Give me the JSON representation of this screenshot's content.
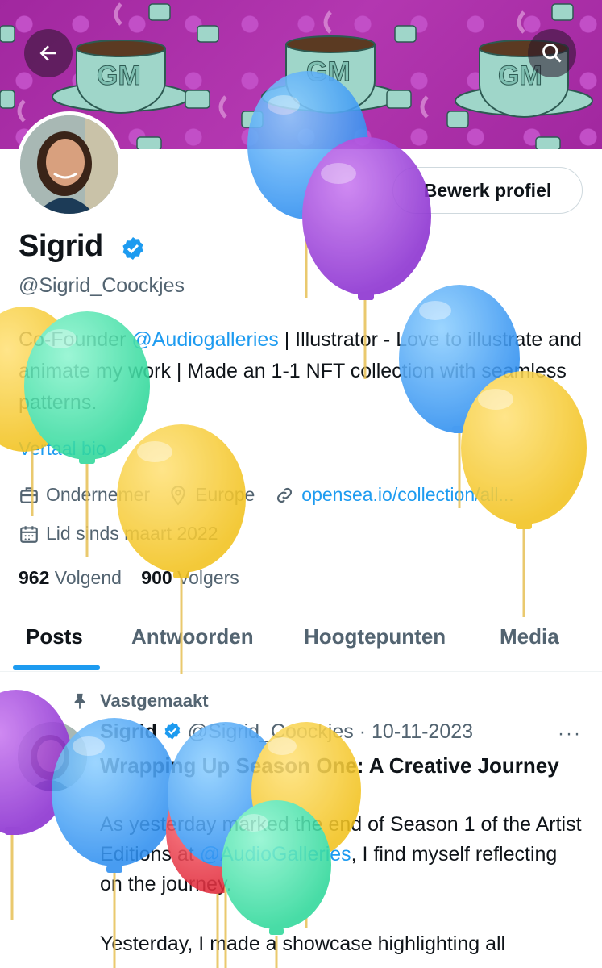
{
  "header": {
    "back_icon": "arrow-left-icon",
    "search_icon": "search-icon",
    "banner_cup_text": "GM"
  },
  "profile": {
    "name": "Sigrid",
    "handle": "@Sigrid_Coockjes",
    "edit_button": "Bewerk profiel",
    "bio_prefix": "Co-Founder ",
    "bio_mention": "@Audiogalleries",
    "bio_rest": " | Illustrator - Love to illustrate and animate my work | Made an 1-1 NFT collection with seamless patterns.",
    "translate_bio": "Vertaal bio",
    "occupation": "Ondernemer",
    "location": "Europe",
    "website": "opensea.io/collection/all...",
    "joined": "Lid sinds maart 2022",
    "following_count": "962",
    "following_label": "Volgend",
    "followers_count": "900",
    "followers_label": "Volgers"
  },
  "tabs": [
    {
      "label": "Posts",
      "active": true
    },
    {
      "label": "Antwoorden",
      "active": false
    },
    {
      "label": "Hoogtepunten",
      "active": false
    },
    {
      "label": "Media",
      "active": false
    }
  ],
  "post": {
    "pinned_label": "Vastgemaakt",
    "author_name": "Sigrid",
    "author_handle": "@Sigrid_Coockjes",
    "separator": "·",
    "date": "10-11-2023",
    "more_label": "···",
    "title": "Wrapping Up Season One: A Creative Journey",
    "body_line1_pre": "As yesterday marked the end of Season 1 of the Artist Editions at ",
    "body_mention": "@AudioGalleries",
    "body_line1_post": ", I find myself reflecting on the journey.",
    "body_line2": "Yesterday, I made a showcase highlighting all"
  },
  "colors": {
    "accent": "#1d9bf0",
    "banner": "#a1279f",
    "text_primary": "#0f1419",
    "text_secondary": "#536471"
  }
}
